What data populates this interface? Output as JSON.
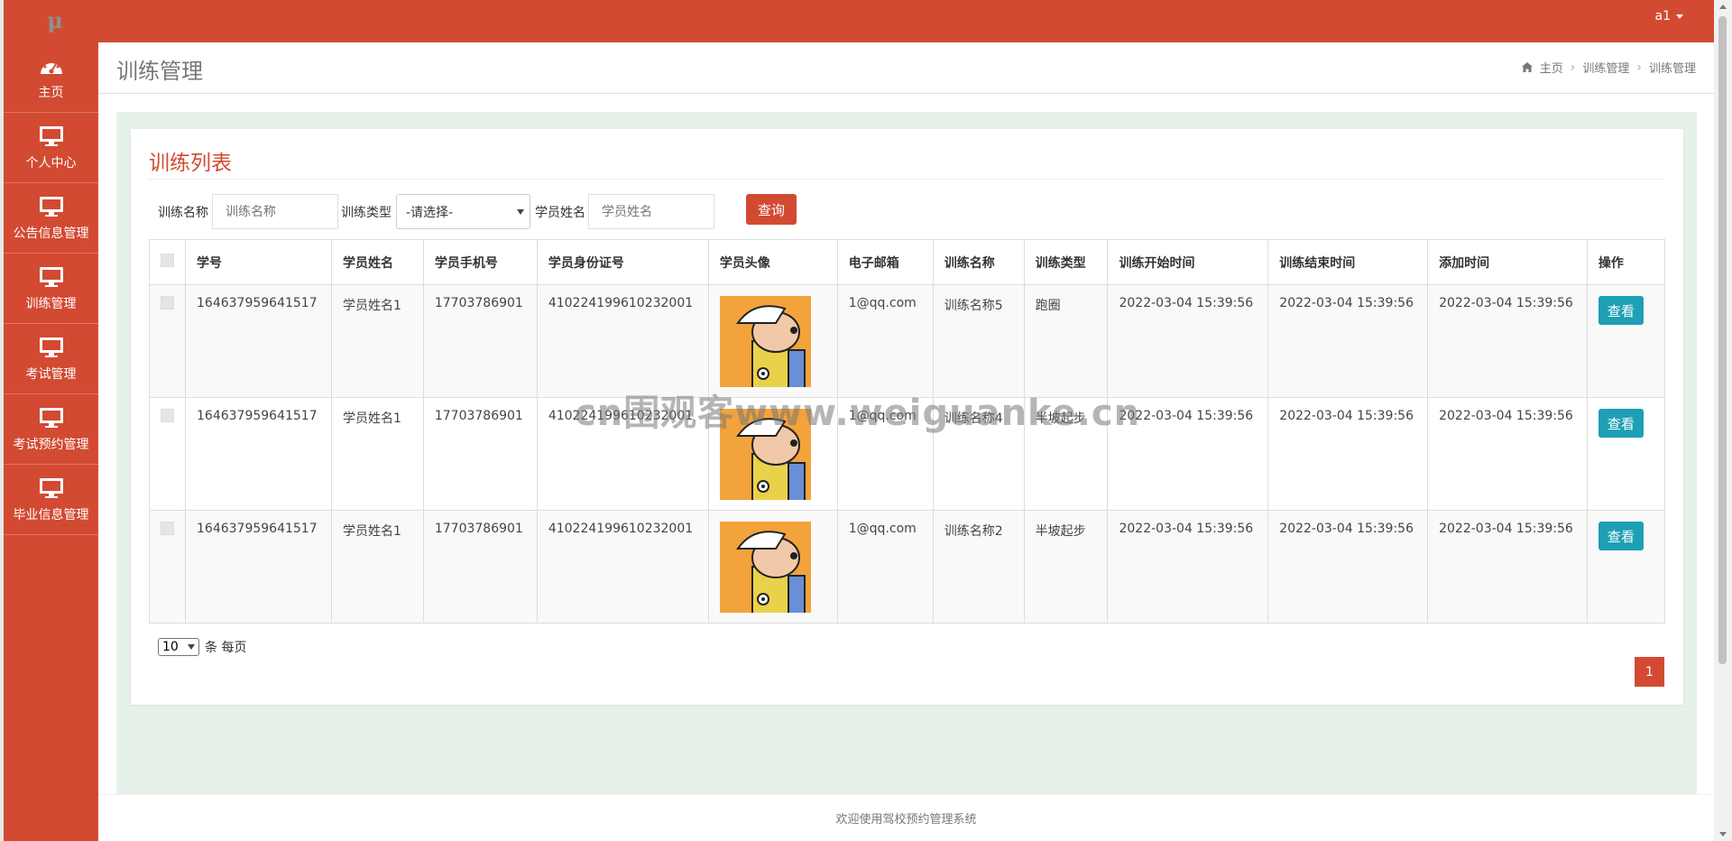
{
  "app": {
    "logo": "μ",
    "user": "a1",
    "accent": "#d24a32",
    "view_button_color": "#1e9fb5"
  },
  "sidebar": {
    "items": [
      {
        "label": "主页",
        "icon": "dashboard-icon"
      },
      {
        "label": "个人中心",
        "icon": "monitor-icon"
      },
      {
        "label": "公告信息管理",
        "icon": "monitor-icon"
      },
      {
        "label": "训练管理",
        "icon": "monitor-icon"
      },
      {
        "label": "考试管理",
        "icon": "monitor-icon"
      },
      {
        "label": "考试预约管理",
        "icon": "monitor-icon"
      },
      {
        "label": "毕业信息管理",
        "icon": "monitor-icon"
      }
    ]
  },
  "header": {
    "title": "训练管理",
    "breadcrumb": [
      "主页",
      "训练管理",
      "训练管理"
    ]
  },
  "card": {
    "title": "训练列表"
  },
  "filters": {
    "name_label": "训练名称",
    "name_placeholder": "训练名称",
    "type_label": "训练类型",
    "type_selected": "-请选择-",
    "student_label": "学员姓名",
    "student_placeholder": "学员姓名",
    "query_button": "查询"
  },
  "table": {
    "columns": [
      "学号",
      "学员姓名",
      "学员手机号",
      "学员身份证号",
      "学员头像",
      "电子邮箱",
      "训练名称",
      "训练类型",
      "训练开始时间",
      "训练结束时间",
      "添加时间",
      "操作"
    ],
    "rows": [
      {
        "id": "164637959641517",
        "name": "学员姓名1",
        "phone": "17703786901",
        "idcard": "410224199610232001",
        "email": "1@qq.com",
        "training": "训练名称5",
        "type": "跑圈",
        "start": "2022-03-04 15:39:56",
        "end": "2022-03-04 15:39:56",
        "added": "2022-03-04 15:39:56",
        "action": "查看"
      },
      {
        "id": "164637959641517",
        "name": "学员姓名1",
        "phone": "17703786901",
        "idcard": "410224199610232001",
        "email": "1@qq.com",
        "training": "训练名称4",
        "type": "半坡起步",
        "start": "2022-03-04 15:39:56",
        "end": "2022-03-04 15:39:56",
        "added": "2022-03-04 15:39:56",
        "action": "查看"
      },
      {
        "id": "164637959641517",
        "name": "学员姓名1",
        "phone": "17703786901",
        "idcard": "410224199610232001",
        "email": "1@qq.com",
        "training": "训练名称2",
        "type": "半坡起步",
        "start": "2022-03-04 15:39:56",
        "end": "2022-03-04 15:39:56",
        "added": "2022-03-04 15:39:56",
        "action": "查看"
      }
    ]
  },
  "pagination": {
    "page_size": "10",
    "page_size_suffix": "条 每页",
    "current_page": "1"
  },
  "footer": {
    "text": "欢迎使用驾校预约管理系统"
  },
  "watermark": "cn围观客www.weiguanke.cn"
}
